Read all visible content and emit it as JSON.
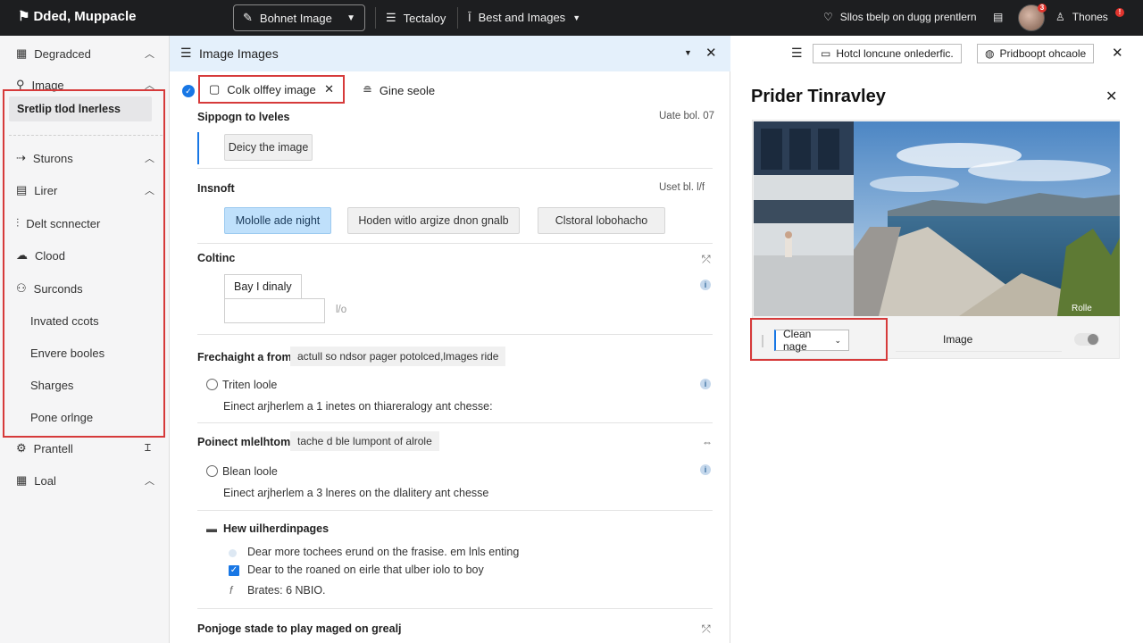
{
  "topbar": {
    "brand": "Dded, Muppacle",
    "select_label": "Bohnet Image",
    "menu1": "Tectaloy",
    "menu2": "Best and Images",
    "status_text": "Sllos tbelp on dugg prentlern",
    "user_name": "Thones",
    "avatar_badge": "3",
    "user_badge": "!"
  },
  "sidebar": {
    "items": [
      {
        "label": "Degradced"
      },
      {
        "label": "Image"
      },
      {
        "label": "Sturons"
      },
      {
        "label": "Lirer"
      },
      {
        "label": "Delt scnnecter"
      },
      {
        "label": "Clood"
      },
      {
        "label": "Surconds"
      },
      {
        "label": "Prantell"
      },
      {
        "label": "Loal"
      }
    ],
    "selected": "Sretlip tlod lnerless",
    "sub_items": [
      "Invated ccots",
      "Envere booles",
      "Sharges",
      "Pone orlnge"
    ]
  },
  "center": {
    "header_title": "Image Images",
    "tab_active": "Colk olffey image",
    "tab_other": "Gine seole",
    "section1": {
      "title": "Sippogn to lveles",
      "meta": "Uate bol. 07",
      "button": "Deicy the image"
    },
    "section2": {
      "title": "Insnoft",
      "meta": "Uset bl. l/f",
      "btn_selected": "Mololle ade night",
      "btn2": "Hoden witlo argize dnon gnalb",
      "btn3": "Clstoral lobohacho"
    },
    "section3": {
      "title": "Coltinc",
      "tab_label": "Bay I dinaly",
      "suffix": "l/o"
    },
    "section4": {
      "title": "Frechaight a from",
      "chip": "actull so ndsor pager potolced,lmages ride",
      "radio_label": "Triten loole",
      "desc": "Einect arjherlem a 1 inetes on thiareralogy ant chesse:"
    },
    "section5": {
      "title": "Poinect mlelhtom",
      "chip": "tache d ble lumpont of alrole",
      "radio_label": "Blean loole",
      "desc": "Einect arjherlem a 3 lneres on the dlalitery ant chesse"
    },
    "section6": {
      "title": "Hew uilherdinpages",
      "line1": "Dear more tochees erund on the frasise. em lnls enting",
      "line2": "Dear to the roaned on eirle that ulber iolo to boy",
      "line3": "Brates: 6 NBIO."
    },
    "section7": {
      "title": "Ponjoge stade to play maged on grealj"
    }
  },
  "right": {
    "btn1": "Hotcl loncune onlederfic.",
    "btn2": "Pridboopt ohcaole",
    "title": "Prider Tinravley",
    "photo_caption": "Rolle",
    "select_label": "Clean nage",
    "image_label": "Image"
  },
  "colors": {
    "topbar_bg": "#1d1e20",
    "accent": "#1877e5",
    "highlight_red": "#d63a3a",
    "selected_btn": "#bfe0fb",
    "header_bg": "#e4f0fb"
  }
}
